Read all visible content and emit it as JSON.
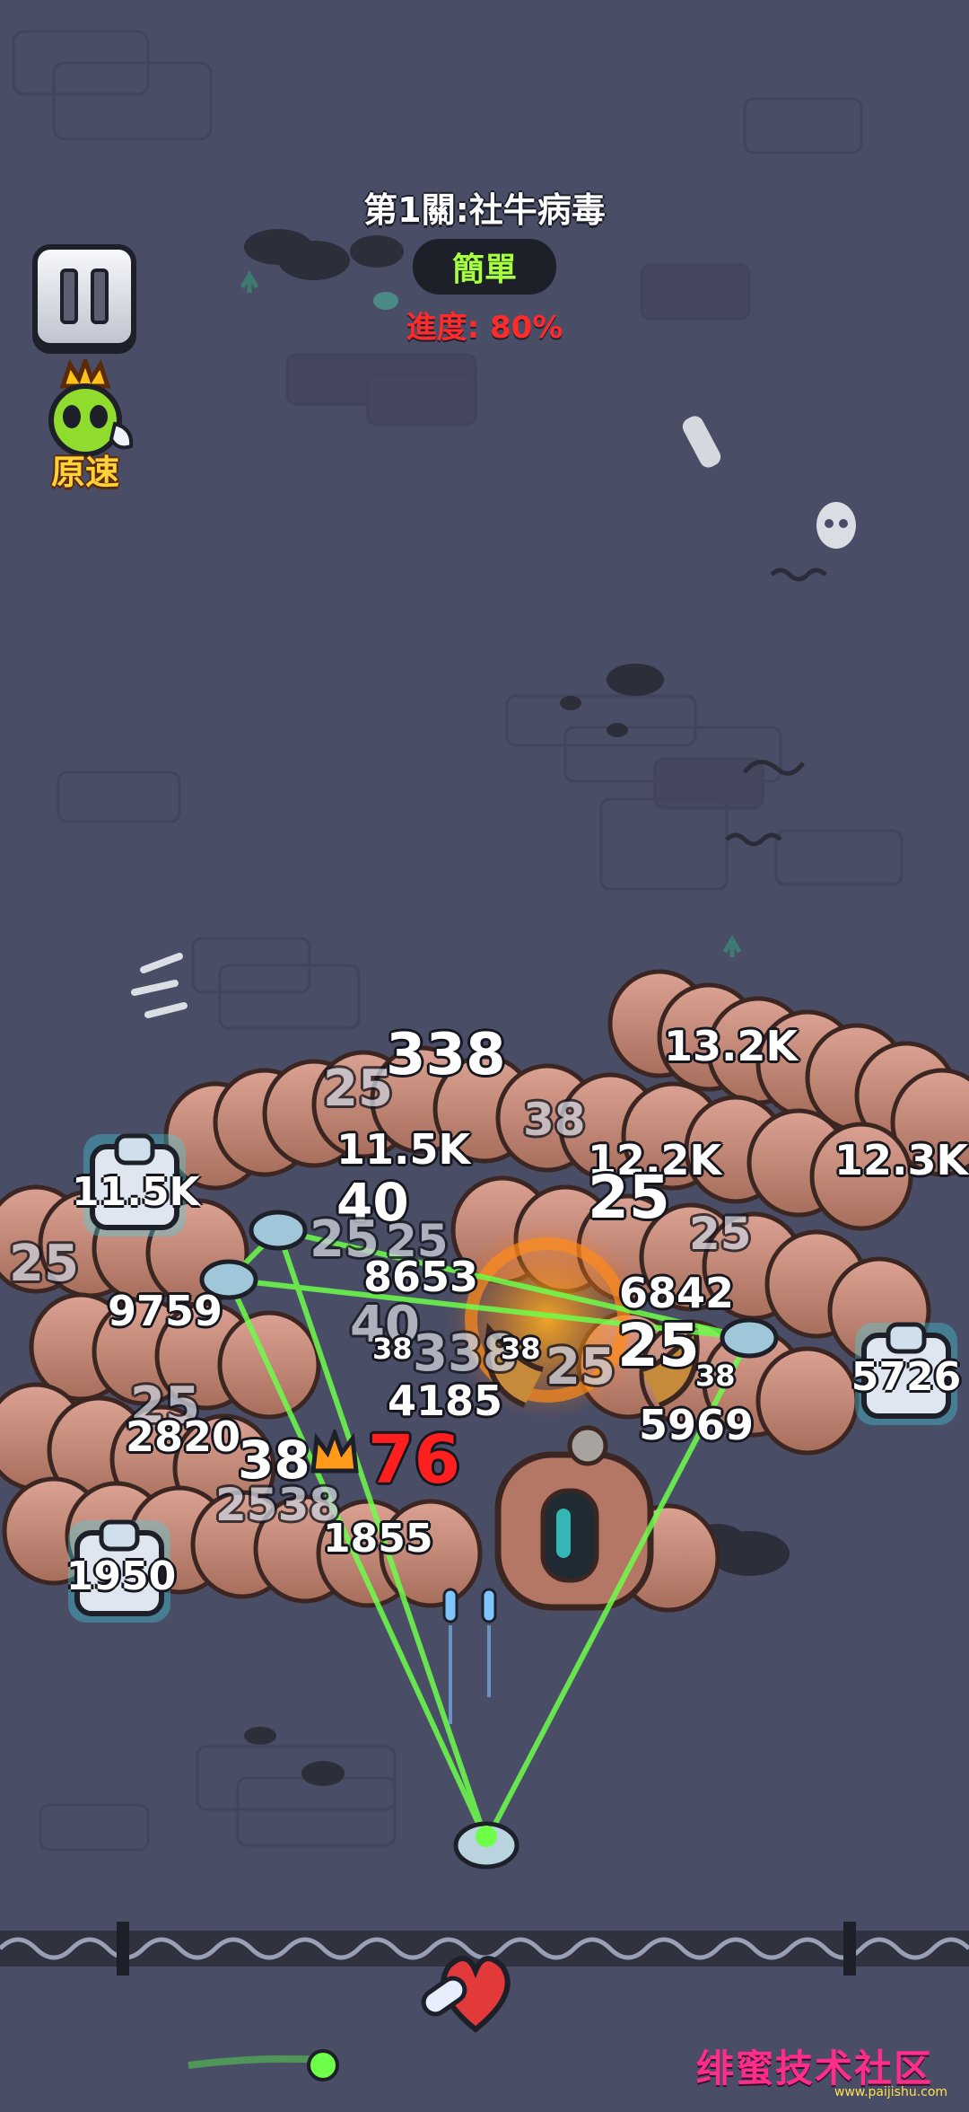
{
  "hud": {
    "level_title": "第1關:社牛病毒",
    "difficulty": "簡單",
    "progress": "進度: 80%",
    "speed_label": "原速",
    "pause_icon": "pause-icon"
  },
  "damage_numbers": [
    {
      "text": "338",
      "style": "normal"
    },
    {
      "text": "13.2K",
      "style": "normal"
    },
    {
      "text": "25",
      "style": "faded"
    },
    {
      "text": "11.5K",
      "style": "normal"
    },
    {
      "text": "38",
      "style": "faded"
    },
    {
      "text": "12.2K",
      "style": "normal"
    },
    {
      "text": "12.3K",
      "style": "normal"
    },
    {
      "text": "25",
      "style": "normal"
    },
    {
      "text": "40",
      "style": "normal"
    },
    {
      "text": "25",
      "style": "faded"
    },
    {
      "text": "25",
      "style": "faded"
    },
    {
      "text": "25",
      "style": "faded"
    },
    {
      "text": "25",
      "style": "faded"
    },
    {
      "text": "8653",
      "style": "normal"
    },
    {
      "text": "6842",
      "style": "normal"
    },
    {
      "text": "9759",
      "style": "normal"
    },
    {
      "text": "40",
      "style": "faded"
    },
    {
      "text": "38",
      "style": "normal"
    },
    {
      "text": "338",
      "style": "faded"
    },
    {
      "text": "38",
      "style": "normal"
    },
    {
      "text": "25",
      "style": "normal"
    },
    {
      "text": "25",
      "style": "faded"
    },
    {
      "text": "38",
      "style": "normal"
    },
    {
      "text": "4185",
      "style": "normal"
    },
    {
      "text": "5969",
      "style": "normal"
    },
    {
      "text": "25",
      "style": "faded"
    },
    {
      "text": "2820",
      "style": "normal"
    },
    {
      "text": "38",
      "style": "normal"
    },
    {
      "text": "76",
      "style": "crit"
    },
    {
      "text": "2538",
      "style": "faded"
    },
    {
      "text": "1855",
      "style": "normal"
    }
  ],
  "chests": [
    {
      "label": "11.5K"
    },
    {
      "label": "5726"
    },
    {
      "label": "1950"
    }
  ],
  "watermark": {
    "text": "绯蜜技术社区",
    "sub": "www.paijishu.com"
  },
  "colors": {
    "background": "#4a4d66",
    "laser": "#6dff4a",
    "worm": "#c98a77",
    "crit": "#ff1f1f",
    "difficulty_text": "#a6ff3f",
    "progress_text": "#ff2a2a"
  }
}
